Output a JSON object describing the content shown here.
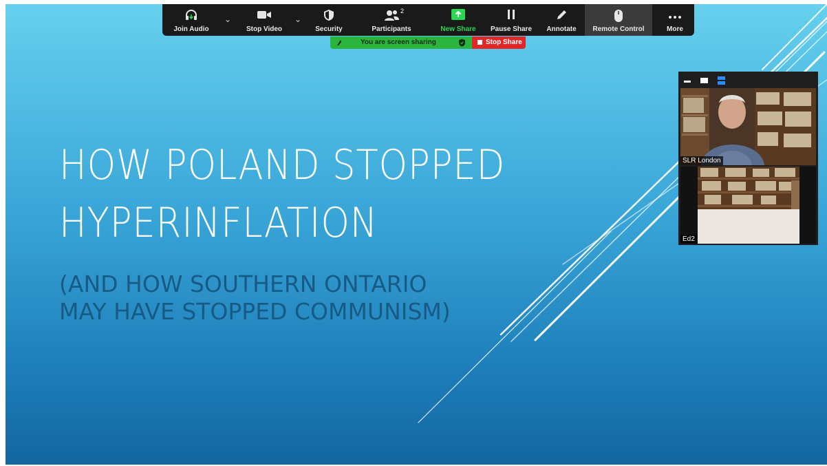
{
  "toolbar": {
    "join_audio": "Join Audio",
    "stop_video": "Stop Video",
    "security": "Security",
    "participants": "Participants",
    "participants_count": "2",
    "new_share": "New Share",
    "pause_share": "Pause Share",
    "annotate": "Annotate",
    "remote_control": "Remote Control",
    "more": "More",
    "accent": "#2bd653"
  },
  "sharing": {
    "status": "You are screen sharing",
    "stop_label": "Stop Share",
    "banner_color": "#2bb43e",
    "stop_color": "#e02828"
  },
  "slide": {
    "title_line1": "HOW POLAND STOPPED",
    "title_line2": "HYPERINFLATION",
    "subtitle_line1": "(AND HOW SOUTHERN ONTARIO",
    "subtitle_line2": "MAY HAVE STOPPED COMMUNISM)"
  },
  "video_panel": {
    "participants": [
      {
        "name": "SLR London"
      },
      {
        "name": "Ed2"
      }
    ]
  }
}
